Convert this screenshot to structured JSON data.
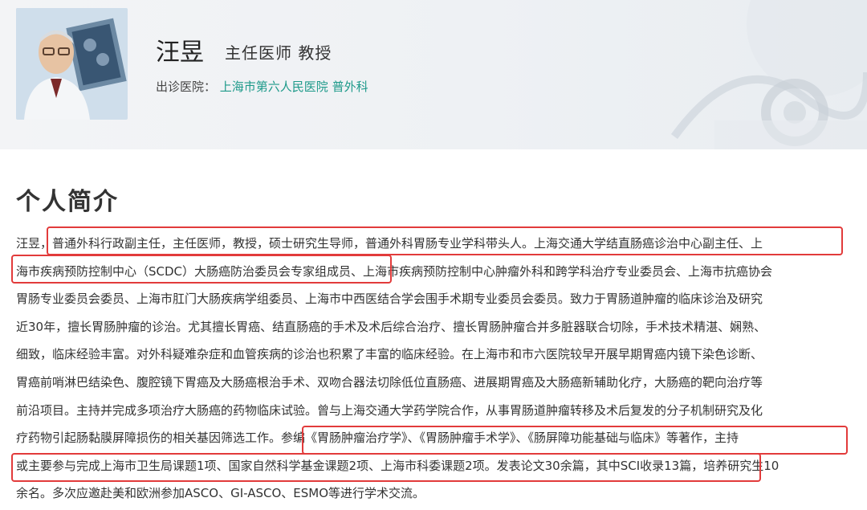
{
  "header": {
    "name": "汪昱",
    "title": "主任医师  教授",
    "clinic_label": "出诊医院：",
    "clinic_value": "上海市第六人民医院 普外科"
  },
  "section": {
    "title": "个人简介"
  },
  "bio": {
    "lines": [
      "汪昱，普通外科行政副主任，主任医师，教授，硕士研究生导师，普通外科胃肠专业学科带头人。上海交通大学结直肠癌诊治中心副主任、上",
      "海市疾病预防控制中心（SCDC）大肠癌防治委员会专家组成员、上海市疾病预防控制中心肿瘤外科和跨学科治疗专业委员会、上海市抗癌协会",
      "胃肠专业委员会委员、上海市肛门大肠疾病学组委员、上海市中西医结合学会围手术期专业委员会委员。致力于胃肠道肿瘤的临床诊治及研究",
      "近30年，擅长胃肠肿瘤的诊治。尤其擅长胃癌、结直肠癌的手术及术后综合治疗、擅长胃肠肿瘤合并多脏器联合切除，手术技术精湛、娴熟、",
      "细致，临床经验丰富。对外科疑难杂症和血管疾病的诊治也积累了丰富的临床经验。在上海市和市六医院较早开展早期胃癌内镜下染色诊断、",
      "胃癌前哨淋巴结染色、腹腔镜下胃癌及大肠癌根治手术、双吻合器法切除低位直肠癌、进展期胃癌及大肠癌新辅助化疗，大肠癌的靶向治疗等",
      "前沿项目。主持并完成多项治疗大肠癌的药物临床试验。曾与上海交通大学药学院合作，从事胃肠道肿瘤转移及术后复发的分子机制研究及化",
      "疗药物引起肠黏膜屏障损伤的相关基因筛选工作。参编《胃肠肿瘤治疗学》、《胃肠肿瘤手术学》、《肠屏障功能基础与临床》等著作，主持",
      "或主要参与完成上海市卫生局课题1项、国家自然科学基金课题2项、上海市科委课题2项。发表论文30余篇，其中SCI收录13篇，培养研究生10",
      "余名。多次应邀赴美和欧洲参加ASCO、GI-ASCO、ESMO等进行学术交流。"
    ]
  },
  "colors": {
    "accent": "#1e9a8a",
    "highlight_border": "#e23b3b"
  }
}
